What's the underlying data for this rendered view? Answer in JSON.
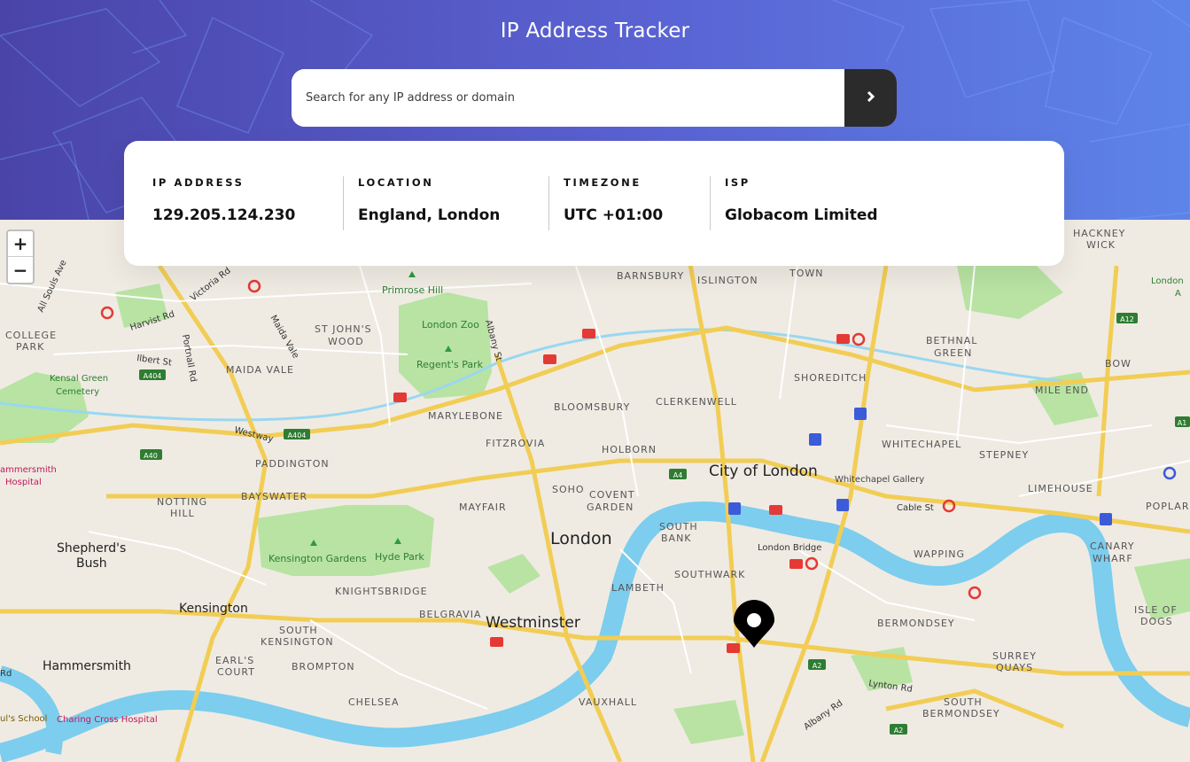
{
  "header": {
    "title": "IP Address Tracker"
  },
  "search": {
    "placeholder": "Search for any IP address or domain",
    "value": "",
    "submit_icon": "chevron-right-icon"
  },
  "info": {
    "ip": {
      "label": "IP ADDRESS",
      "value": "129.205.124.230"
    },
    "location": {
      "label": "LOCATION",
      "value": "England, London"
    },
    "timezone": {
      "label": "TIMEZONE",
      "value": "UTC +01:00"
    },
    "isp": {
      "label": "ISP",
      "value": "Globacom Limited"
    }
  },
  "map": {
    "zoom_in": "+",
    "zoom_out": "−",
    "marker_icon": "location-pin-icon",
    "labels": {
      "london": "London",
      "city_of_london": "City of London",
      "westminster": "Westminster",
      "kensington": "Kensington",
      "hammersmith": "Hammersmith",
      "shepherds_bush_1": "Shepherd's",
      "shepherds_bush_2": "Bush",
      "primrose_hill": "Primrose Hill",
      "london_zoo": "London Zoo",
      "regents_park": "Regent's Park",
      "st_johns_wood_1": "ST JOHN'S",
      "st_johns_wood_2": "WOOD",
      "maida_vale": "MAIDA VALE",
      "marylebone": "MARYLEBONE",
      "bloomsbury": "BLOOMSBURY",
      "clerkenwell": "CLERKENWELL",
      "shoreditch": "SHOREDITCH",
      "barnsbury": "BARNSBURY",
      "islington": "ISLINGTON",
      "town": "TOWN",
      "bethnal_green_1": "BETHNAL",
      "bethnal_green_2": "GREEN",
      "bow": "BOW",
      "mile_end": "MILE END",
      "hackney_wick_1": "HACKNEY",
      "hackney_wick_2": "WICK",
      "whitechapel": "WHITECHAPEL",
      "stepney": "STEPNEY",
      "whitechapel_gallery": "Whitechapel Gallery",
      "limehouse": "LIMEHOUSE",
      "cable_st": "Cable St",
      "poplar": "POPLAR",
      "canary_wharf_1": "CANARY",
      "canary_wharf_2": "WHARF",
      "fitzrovia": "FITZROVIA",
      "holborn": "HOLBORN",
      "paddington": "PADDINGTON",
      "bayswater": "BAYSWATER",
      "notting_hill_1": "NOTTING",
      "notting_hill_2": "HILL",
      "soho": "SOHO",
      "covent_garden_1": "COVENT",
      "covent_garden_2": "GARDEN",
      "mayfair": "MAYFAIR",
      "south_bank_1": "SOUTH",
      "south_bank_2": "BANK",
      "london_bridge": "London Bridge",
      "southwark": "SOUTHWARK",
      "wapping": "WAPPING",
      "kensington_gardens": "Kensington Gardens",
      "hyde_park": "Hyde Park",
      "knightsbridge": "KNIGHTSBRIDGE",
      "belgravia": "BELGRAVIA",
      "lambeth": "LAMBETH",
      "south_kensington_1": "SOUTH",
      "south_kensington_2": "KENSINGTON",
      "brompton": "BROMPTON",
      "earls_court_1": "EARL'S",
      "earls_court_2": "COURT",
      "chelsea": "CHELSEA",
      "vauxhall": "VAUXHALL",
      "bermondsey": "BERMONDSEY",
      "surrey_quays_1": "SURREY",
      "surrey_quays_2": "QUAYS",
      "isle_of_dogs_1": "ISLE OF",
      "isle_of_dogs_2": "DOGS",
      "south_bermondsey_1": "SOUTH",
      "south_bermondsey_2": "BERMONDSEY",
      "lynton_rd": "Lynton Rd",
      "albany_rd": "Albany Rd",
      "albany_st": "Albany St",
      "college_park_1": "COLLEGE",
      "college_park_2": "PARK",
      "kensal_green_1": "Kensal Green",
      "kensal_green_2": "Cemetery",
      "harvist_rd": "Harvist Rd",
      "victoria_rd": "Victoria Rd",
      "all_souls_ave": "All Souls Ave",
      "ilbert_st": "Ilbert St",
      "portnall_rd": "Portnall Rd",
      "maida_vale_rd": "Maida Vale",
      "westway": "Westway",
      "hammersmith_hospital_1": "ammersmith",
      "hammersmith_hospital_2": "Hospital",
      "charing_cross_hospital": "Charing Cross Hospital",
      "pauls_school": "ul's School",
      "rd_left": "Rd",
      "london_a_1": "London",
      "london_a_2": "A"
    },
    "road_shields": {
      "a404_1": "A404",
      "a404_2": "A404",
      "a40": "A40",
      "a4": "A4",
      "a2_1": "A2",
      "a2_2": "A2",
      "a12": "A12",
      "a1": "A1"
    },
    "colors": {
      "land": "#efebe3",
      "park": "#b8e3a3",
      "water": "#7ccdee",
      "major_road": "#f2cd55",
      "road": "#ffffff",
      "marker": "#000000"
    }
  }
}
